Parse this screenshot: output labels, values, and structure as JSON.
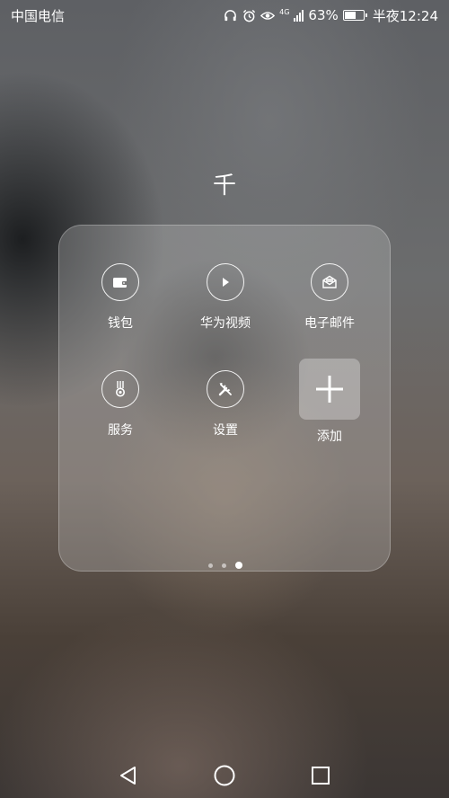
{
  "status_bar": {
    "carrier": "中国电信",
    "network": "4G",
    "battery_percent": "63%",
    "battery_level": 0.63,
    "time": "半夜12:24",
    "icons": [
      "headphones-icon",
      "alarm-icon",
      "eye-icon",
      "signal-icon",
      "battery-icon"
    ]
  },
  "folder": {
    "title": "千",
    "apps": [
      {
        "label": "钱包",
        "icon": "wallet-icon"
      },
      {
        "label": "华为视频",
        "icon": "play-icon"
      },
      {
        "label": "电子邮件",
        "icon": "email-icon"
      },
      {
        "label": "服务",
        "icon": "medal-icon"
      },
      {
        "label": "设置",
        "icon": "tools-icon"
      }
    ],
    "add_label": "添加",
    "page_count": 3,
    "active_page": 3
  },
  "nav_bar": {
    "icons": [
      "back-icon",
      "home-icon",
      "recents-icon"
    ]
  }
}
